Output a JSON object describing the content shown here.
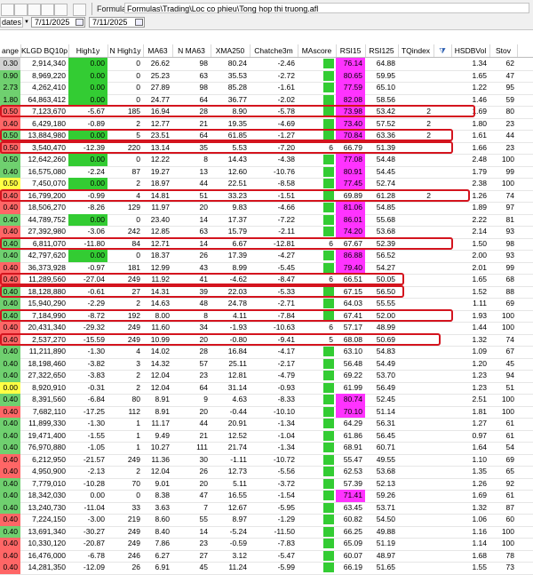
{
  "toolbar": {
    "formula_label": "Formula",
    "formula_path": "Formulas\\Trading\\Loc co phieu\\Tong hop thi truong.afl",
    "range_label": "dates",
    "date_from": "7/11/2025",
    "date_to": "7/11/2025"
  },
  "table": {
    "columns": [
      "ange",
      "KLGD BQ10p",
      "High1y",
      "N High1y",
      "MA63",
      "N MA63",
      "XMA250",
      "Chatche3m",
      "MAscore",
      "RSI15",
      "RSI125",
      "TQindex",
      "",
      "HSDBVol",
      "Stov"
    ],
    "rows": [
      {
        "chg": "0.30",
        "k": "2,914,340",
        "h": "0.00",
        "nh": "0",
        "ma": "26.62",
        "nma": "98",
        "x": "80.24",
        "ct": "-2.46",
        "ms": "",
        "rsi": "76.14",
        "r125": "64.88",
        "tq": "",
        "hs": "1.34",
        "st": "62"
      },
      {
        "chg": "0.90",
        "k": "8,969,220",
        "h": "0.00",
        "nh": "0",
        "ma": "25.23",
        "nma": "63",
        "x": "35.53",
        "ct": "-2.72",
        "ms": "",
        "rsi": "80.65",
        "r125": "59.95",
        "tq": "",
        "hs": "1.65",
        "st": "47"
      },
      {
        "chg": "2.73",
        "k": "4,262,410",
        "h": "0.00",
        "nh": "0",
        "ma": "27.89",
        "nma": "98",
        "x": "85.28",
        "ct": "-1.61",
        "ms": "",
        "rsi": "77.59",
        "r125": "65.10",
        "tq": "",
        "hs": "1.22",
        "st": "95"
      },
      {
        "chg": "1.80",
        "k": "64,863,412",
        "h": "0.00",
        "nh": "0",
        "ma": "24.77",
        "nma": "64",
        "x": "36.77",
        "ct": "-2.02",
        "ms": "",
        "rsi": "82.08",
        "r125": "58.56",
        "tq": "",
        "hs": "1.46",
        "st": "59"
      },
      {
        "chg": "0.50",
        "k": "7,123,670",
        "h": "-5.67",
        "nh": "185",
        "ma": "16.94",
        "nma": "28",
        "x": "8.90",
        "ct": "-5.78",
        "ms": "",
        "rsi": "73.98",
        "r125": "53.42",
        "tq": "2",
        "hs": "1.69",
        "st": "80"
      },
      {
        "chg": "0.40",
        "k": "6,429,180",
        "h": "-0.89",
        "nh": "2",
        "ma": "12.77",
        "nma": "21",
        "x": "19.35",
        "ct": "-4.69",
        "ms": "",
        "rsi": "73.40",
        "r125": "57.52",
        "tq": "2",
        "hs": "1.80",
        "st": "23"
      },
      {
        "chg": "0.50",
        "k": "13,884,980",
        "h": "0.00",
        "nh": "5",
        "ma": "23.51",
        "nma": "64",
        "x": "61.85",
        "ct": "-1.27",
        "ms": "",
        "rsi": "70.84",
        "r125": "63.36",
        "tq": "2",
        "hs": "1.61",
        "st": "44"
      },
      {
        "chg": "0.50",
        "k": "3,540,470",
        "h": "-12.39",
        "nh": "220",
        "ma": "13.14",
        "nma": "35",
        "x": "5.53",
        "ct": "-7.20",
        "ms": "6",
        "rsi": "66.79",
        "r125": "51.39",
        "tq": "",
        "hs": "1.66",
        "st": "23"
      },
      {
        "chg": "0.50",
        "k": "12,642,260",
        "h": "0.00",
        "nh": "0",
        "ma": "12.22",
        "nma": "8",
        "x": "14.43",
        "ct": "-4.38",
        "ms": "",
        "rsi": "77.08",
        "r125": "54.48",
        "tq": "",
        "hs": "2.48",
        "st": "100"
      },
      {
        "chg": "0.40",
        "k": "16,575,080",
        "h": "-2.24",
        "nh": "87",
        "ma": "19.27",
        "nma": "13",
        "x": "12.60",
        "ct": "-10.76",
        "ms": "",
        "rsi": "80.91",
        "r125": "54.45",
        "tq": "",
        "hs": "1.79",
        "st": "99"
      },
      {
        "chg": "0.50",
        "k": "7,450,070",
        "h": "0.00",
        "nh": "2",
        "ma": "18.97",
        "nma": "44",
        "x": "22.51",
        "ct": "-8.58",
        "ms": "",
        "rsi": "77.45",
        "r125": "52.74",
        "tq": "",
        "hs": "2.38",
        "st": "100"
      },
      {
        "chg": "0.40",
        "k": "16,799,200",
        "h": "-0.99",
        "nh": "4",
        "ma": "14.81",
        "nma": "51",
        "x": "33.23",
        "ct": "-1.51",
        "ms": "",
        "rsi": "69.89",
        "r125": "61.28",
        "tq": "2",
        "hs": "1.26",
        "st": "74"
      },
      {
        "chg": "0.40",
        "k": "18,506,270",
        "h": "-8.26",
        "nh": "129",
        "ma": "11.97",
        "nma": "20",
        "x": "9.83",
        "ct": "-4.66",
        "ms": "",
        "rsi": "81.06",
        "r125": "54.85",
        "tq": "",
        "hs": "1.89",
        "st": "97"
      },
      {
        "chg": "0.40",
        "k": "44,789,752",
        "h": "0.00",
        "nh": "0",
        "ma": "23.40",
        "nma": "14",
        "x": "17.37",
        "ct": "-7.22",
        "ms": "",
        "rsi": "86.01",
        "r125": "55.68",
        "tq": "",
        "hs": "2.22",
        "st": "81"
      },
      {
        "chg": "0.40",
        "k": "27,392,980",
        "h": "-3.06",
        "nh": "242",
        "ma": "12.85",
        "nma": "63",
        "x": "15.79",
        "ct": "-2.11",
        "ms": "",
        "rsi": "74.20",
        "r125": "53.68",
        "tq": "",
        "hs": "2.14",
        "st": "93"
      },
      {
        "chg": "0.40",
        "k": "6,811,070",
        "h": "-11.80",
        "nh": "84",
        "ma": "12.71",
        "nma": "14",
        "x": "6.67",
        "ct": "-12.81",
        "ms": "6",
        "rsi": "67.67",
        "r125": "52.39",
        "tq": "",
        "hs": "1.50",
        "st": "98"
      },
      {
        "chg": "0.40",
        "k": "42,797,620",
        "h": "0.00",
        "nh": "0",
        "ma": "18.37",
        "nma": "26",
        "x": "17.39",
        "ct": "-4.27",
        "ms": "",
        "rsi": "86.88",
        "r125": "56.52",
        "tq": "",
        "hs": "2.00",
        "st": "93"
      },
      {
        "chg": "0.40",
        "k": "36,373,928",
        "h": "-0.97",
        "nh": "181",
        "ma": "12.99",
        "nma": "43",
        "x": "8.99",
        "ct": "-5.45",
        "ms": "",
        "rsi": "79.40",
        "r125": "54.27",
        "tq": "",
        "hs": "2.01",
        "st": "99"
      },
      {
        "chg": "0.40",
        "k": "11,289,560",
        "h": "-27.04",
        "nh": "249",
        "ma": "11.92",
        "nma": "41",
        "x": "-4.62",
        "ct": "-8.47",
        "ms": "6",
        "rsi": "66.51",
        "r125": "50.05",
        "tq": "",
        "hs": "1.65",
        "st": "68"
      },
      {
        "chg": "0.40",
        "k": "18,128,880",
        "h": "-0.61",
        "nh": "27",
        "ma": "14.31",
        "nma": "39",
        "x": "22.03",
        "ct": "-5.33",
        "ms": "",
        "rsi": "67.15",
        "r125": "56.50",
        "tq": "",
        "hs": "1.52",
        "st": "88"
      },
      {
        "chg": "0.40",
        "k": "15,940,290",
        "h": "-2.29",
        "nh": "2",
        "ma": "14.63",
        "nma": "48",
        "x": "24.78",
        "ct": "-2.71",
        "ms": "",
        "rsi": "64.03",
        "r125": "55.55",
        "tq": "",
        "hs": "1.11",
        "st": "69"
      },
      {
        "chg": "0.40",
        "k": "7,184,990",
        "h": "-8.72",
        "nh": "192",
        "ma": "8.00",
        "nma": "8",
        "x": "4.11",
        "ct": "-7.84",
        "ms": "",
        "rsi": "67.41",
        "r125": "52.00",
        "tq": "",
        "hs": "1.93",
        "st": "100"
      },
      {
        "chg": "0.40",
        "k": "20,431,340",
        "h": "-29.32",
        "nh": "249",
        "ma": "11.60",
        "nma": "34",
        "x": "-1.93",
        "ct": "-10.63",
        "ms": "6",
        "rsi": "57.17",
        "r125": "48.99",
        "tq": "",
        "hs": "1.44",
        "st": "100"
      },
      {
        "chg": "0.40",
        "k": "2,537,270",
        "h": "-15.59",
        "nh": "249",
        "ma": "10.99",
        "nma": "20",
        "x": "-0.80",
        "ct": "-9.41",
        "ms": "5",
        "rsi": "68.08",
        "r125": "50.69",
        "tq": "",
        "hs": "1.32",
        "st": "74"
      },
      {
        "chg": "0.40",
        "k": "11,211,890",
        "h": "-1.30",
        "nh": "4",
        "ma": "14.02",
        "nma": "28",
        "x": "16.84",
        "ct": "-4.17",
        "ms": "",
        "rsi": "63.10",
        "r125": "54.83",
        "tq": "",
        "hs": "1.09",
        "st": "67"
      },
      {
        "chg": "0.40",
        "k": "18,198,460",
        "h": "-3.82",
        "nh": "3",
        "ma": "14.32",
        "nma": "57",
        "x": "25.11",
        "ct": "-2.17",
        "ms": "",
        "rsi": "56.48",
        "r125": "54.49",
        "tq": "",
        "hs": "1.20",
        "st": "45"
      },
      {
        "chg": "0.40",
        "k": "27,322,650",
        "h": "-3.83",
        "nh": "2",
        "ma": "12.04",
        "nma": "23",
        "x": "12.81",
        "ct": "-4.79",
        "ms": "",
        "rsi": "69.22",
        "r125": "53.70",
        "tq": "",
        "hs": "1.23",
        "st": "94"
      },
      {
        "chg": "0.00",
        "k": "8,920,910",
        "h": "-0.31",
        "nh": "2",
        "ma": "12.04",
        "nma": "64",
        "x": "31.14",
        "ct": "-0.93",
        "ms": "",
        "rsi": "61.99",
        "r125": "56.49",
        "tq": "",
        "hs": "1.23",
        "st": "51"
      },
      {
        "chg": "0.40",
        "k": "8,391,560",
        "h": "-6.84",
        "nh": "80",
        "ma": "8.91",
        "nma": "9",
        "x": "4.63",
        "ct": "-8.33",
        "ms": "",
        "rsi": "80.74",
        "r125": "52.45",
        "tq": "",
        "hs": "2.51",
        "st": "100"
      },
      {
        "chg": "0.40",
        "k": "7,682,110",
        "h": "-17.25",
        "nh": "112",
        "ma": "8.91",
        "nma": "20",
        "x": "-0.44",
        "ct": "-10.10",
        "ms": "",
        "rsi": "70.10",
        "r125": "51.14",
        "tq": "",
        "hs": "1.81",
        "st": "100"
      },
      {
        "chg": "0.40",
        "k": "11,899,330",
        "h": "-1.30",
        "nh": "1",
        "ma": "11.17",
        "nma": "44",
        "x": "20.91",
        "ct": "-1.34",
        "ms": "",
        "rsi": "64.29",
        "r125": "56.31",
        "tq": "",
        "hs": "1.27",
        "st": "61"
      },
      {
        "chg": "0.40",
        "k": "19,471,400",
        "h": "-1.55",
        "nh": "1",
        "ma": "9.49",
        "nma": "21",
        "x": "12.52",
        "ct": "-1.04",
        "ms": "",
        "rsi": "61.86",
        "r125": "56.45",
        "tq": "",
        "hs": "0.97",
        "st": "61"
      },
      {
        "chg": "0.40",
        "k": "76,970,880",
        "h": "-1.05",
        "nh": "1",
        "ma": "10.27",
        "nma": "111",
        "x": "21.74",
        "ct": "-1.34",
        "ms": "",
        "rsi": "68.91",
        "r125": "60.71",
        "tq": "",
        "hs": "1.64",
        "st": "54"
      },
      {
        "chg": "0.40",
        "k": "6,212,950",
        "h": "-21.57",
        "nh": "249",
        "ma": "11.36",
        "nma": "30",
        "x": "-1.11",
        "ct": "-10.72",
        "ms": "",
        "rsi": "55.47",
        "r125": "49.55",
        "tq": "",
        "hs": "1.10",
        "st": "69"
      },
      {
        "chg": "0.40",
        "k": "4,950,900",
        "h": "-2.13",
        "nh": "2",
        "ma": "12.04",
        "nma": "26",
        "x": "12.73",
        "ct": "-5.56",
        "ms": "",
        "rsi": "62.53",
        "r125": "53.68",
        "tq": "",
        "hs": "1.35",
        "st": "65"
      },
      {
        "chg": "0.40",
        "k": "7,779,010",
        "h": "-10.28",
        "nh": "70",
        "ma": "9.01",
        "nma": "20",
        "x": "5.11",
        "ct": "-3.72",
        "ms": "",
        "rsi": "57.39",
        "r125": "52.13",
        "tq": "",
        "hs": "1.26",
        "st": "92"
      },
      {
        "chg": "0.40",
        "k": "18,342,030",
        "h": "0.00",
        "nh": "0",
        "ma": "8.38",
        "nma": "47",
        "x": "16.55",
        "ct": "-1.54",
        "ms": "",
        "rsi": "71.41",
        "r125": "59.26",
        "tq": "",
        "hs": "1.69",
        "st": "61"
      },
      {
        "chg": "0.40",
        "k": "13,240,730",
        "h": "-11.04",
        "nh": "33",
        "ma": "3.63",
        "nma": "7",
        "x": "12.67",
        "ct": "-5.95",
        "ms": "",
        "rsi": "63.45",
        "r125": "53.71",
        "tq": "",
        "hs": "1.32",
        "st": "87"
      },
      {
        "chg": "0.40",
        "k": "7,224,150",
        "h": "-3.00",
        "nh": "219",
        "ma": "8.60",
        "nma": "55",
        "x": "8.97",
        "ct": "-1.29",
        "ms": "",
        "rsi": "60.82",
        "r125": "54.50",
        "tq": "",
        "hs": "1.06",
        "st": "60"
      },
      {
        "chg": "0.40",
        "k": "13,691,340",
        "h": "-30.27",
        "nh": "249",
        "ma": "8.40",
        "nma": "14",
        "x": "-5.24",
        "ct": "-11.50",
        "ms": "",
        "rsi": "66.25",
        "r125": "49.88",
        "tq": "",
        "hs": "1.16",
        "st": "100"
      },
      {
        "chg": "0.40",
        "k": "10,330,120",
        "h": "-20.87",
        "nh": "249",
        "ma": "7.86",
        "nma": "23",
        "x": "-0.59",
        "ct": "-7.83",
        "ms": "",
        "rsi": "65.09",
        "r125": "51.19",
        "tq": "",
        "hs": "1.14",
        "st": "100"
      },
      {
        "chg": "0.40",
        "k": "16,476,000",
        "h": "-6.78",
        "nh": "246",
        "ma": "6.27",
        "nma": "27",
        "x": "3.12",
        "ct": "-5.47",
        "ms": "",
        "rsi": "60.07",
        "r125": "48.97",
        "tq": "",
        "hs": "1.68",
        "st": "78"
      },
      {
        "chg": "0.40",
        "k": "14,281,350",
        "h": "-12.09",
        "nh": "26",
        "ma": "6.91",
        "nma": "45",
        "x": "11.24",
        "ct": "-5.99",
        "ms": "",
        "rsi": "66.19",
        "r125": "51.65",
        "tq": "",
        "hs": "1.55",
        "st": "73"
      }
    ]
  },
  "colors": {
    "green": "#33cc33",
    "magenta": "#ff33ff",
    "yellow": "#ffff00",
    "highlight": "#d4141e"
  }
}
